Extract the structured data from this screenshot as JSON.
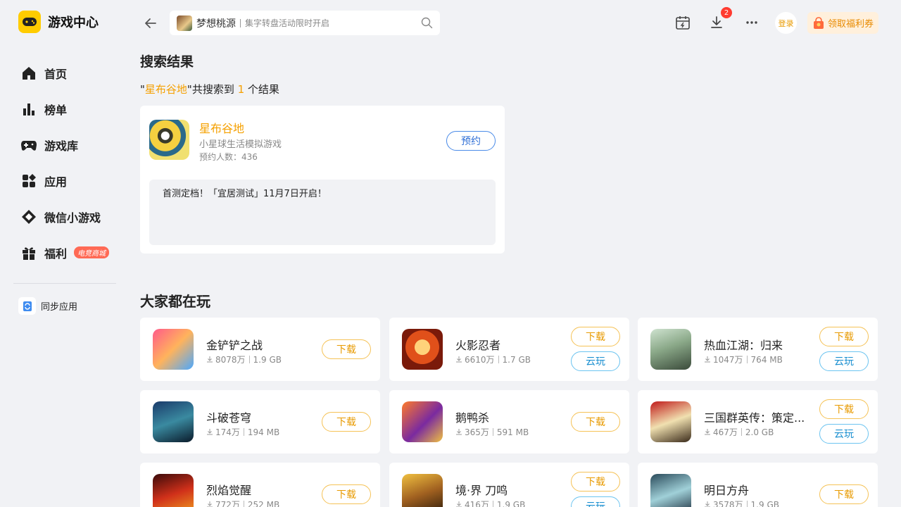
{
  "app": {
    "title": "游戏中心"
  },
  "sidebar": {
    "items": [
      {
        "label": "首页",
        "icon": "home-icon"
      },
      {
        "label": "榜单",
        "icon": "chart-icon"
      },
      {
        "label": "游戏库",
        "icon": "gamepad-icon"
      },
      {
        "label": "应用",
        "icon": "apps-icon"
      },
      {
        "label": "微信小游戏",
        "icon": "diamond-icon"
      },
      {
        "label": "福利",
        "icon": "gift-icon",
        "badge": "电竞商城"
      }
    ],
    "sync_label": "同步应用"
  },
  "search": {
    "game": "梦想桃源",
    "hint": "集字转盘活动限时开启"
  },
  "header": {
    "download_count": "2",
    "login_label": "登录",
    "coupon_label": "领取福利券"
  },
  "results": {
    "title": "搜索结果",
    "quote_open": "\"",
    "query": "星布谷地",
    "mid_text": "\"共搜索到 ",
    "count": "1",
    "suffix": " 个结果",
    "card": {
      "name": "星布谷地",
      "desc": "小星球生活模拟游戏",
      "reserve_count": "预约人数：436",
      "button": "预约",
      "notice": "首测定档！「宜居测试」11月7日开启！"
    }
  },
  "popular": {
    "title": "大家都在玩",
    "download_label": "下载",
    "cloud_label": "云玩",
    "games": [
      {
        "name": "金铲铲之战",
        "downloads": "8078万",
        "size": "1.9 GB",
        "cloud": false
      },
      {
        "name": "火影忍者",
        "downloads": "6610万",
        "size": "1.7 GB",
        "cloud": true
      },
      {
        "name": "热血江湖：归来",
        "downloads": "1047万",
        "size": "764 MB",
        "cloud": true
      },
      {
        "name": "斗破苍穹",
        "downloads": "174万",
        "size": "194 MB",
        "cloud": false
      },
      {
        "name": "鹅鸭杀",
        "downloads": "365万",
        "size": "591 MB",
        "cloud": false
      },
      {
        "name": "三国群英传：策定...",
        "downloads": "467万",
        "size": "2.0 GB",
        "cloud": true
      },
      {
        "name": "烈焰觉醒",
        "downloads": "772万",
        "size": "252 MB",
        "cloud": false
      },
      {
        "name": "境·界 刀鸣",
        "downloads": "416万",
        "size": "1.9 GB",
        "cloud": true
      },
      {
        "name": "明日方舟",
        "downloads": "3578万",
        "size": "1.9 GB",
        "cloud": false
      }
    ]
  },
  "colors": {
    "accent": "#f5a000",
    "blue": "#2f6fd6",
    "bg": "#f1f2f5"
  }
}
